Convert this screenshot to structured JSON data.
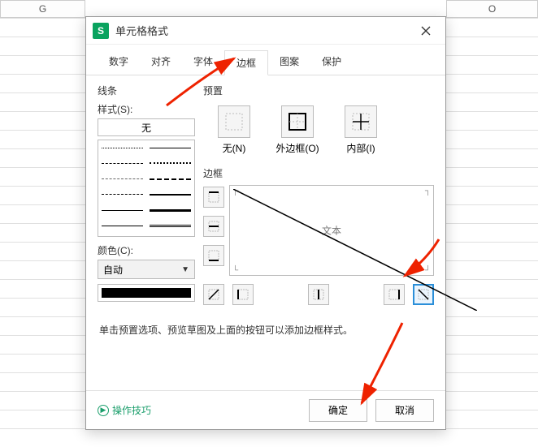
{
  "spreadsheet": {
    "colG": "G",
    "colO": "O"
  },
  "dialog": {
    "title": "单元格格式",
    "tabs": [
      "数字",
      "对齐",
      "字体",
      "边框",
      "图案",
      "保护"
    ],
    "activeTab": 3
  },
  "line": {
    "section": "线条",
    "styleLabel": "样式(S):",
    "styleValue": "无",
    "colorLabel": "颜色(C):",
    "colorValue": "自动"
  },
  "presets": {
    "section": "预置",
    "items": [
      {
        "label": "无(N)",
        "icon": "none"
      },
      {
        "label": "外边框(O)",
        "icon": "outline"
      },
      {
        "label": "内部(I)",
        "icon": "inside"
      }
    ]
  },
  "border": {
    "section": "边框",
    "previewText": "文本"
  },
  "hint": "单击预置选项、预览草图及上面的按钮可以添加边框样式。",
  "footer": {
    "tips": "操作技巧",
    "ok": "确定",
    "cancel": "取消"
  }
}
